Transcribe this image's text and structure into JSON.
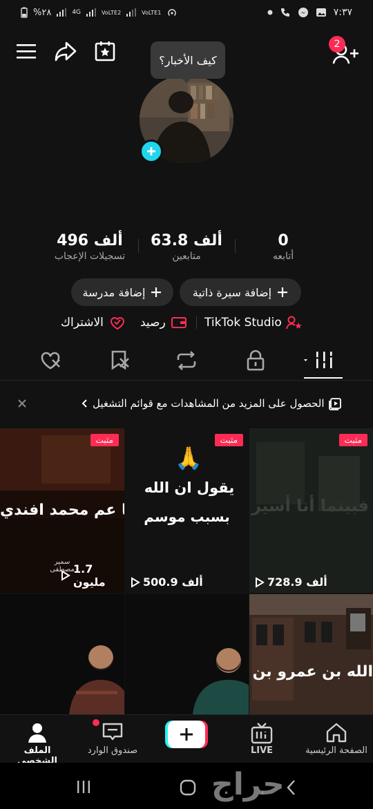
{
  "status_bar": {
    "time": "٧:٣٧",
    "battery": "%٢٨",
    "network_1": "4G",
    "network_2": "VoLTE2",
    "network_3": "VoLTE1"
  },
  "profile": {
    "whats_new_bubble": "كيف الأخبار؟",
    "notification_badge": "2"
  },
  "stats": [
    {
      "value": "0",
      "label": "أتابعه"
    },
    {
      "value": "63.8 ألف",
      "label": "متابعين"
    },
    {
      "value": "496 ألف",
      "label": "تسجيلات الإعجاب"
    }
  ],
  "actions": {
    "add_bio": "إضافة سيرة ذاتية",
    "add_school": "إضافة مدرسة"
  },
  "links": {
    "studio": "TikTok Studio",
    "balance": "رصيد",
    "subscription": "الاشتراك"
  },
  "banner": {
    "text": "الحصول على المزيد من المشاهدات مع قوائم التشغيل"
  },
  "videos": [
    {
      "pinned": "مثبت",
      "views": "728.9 ألف",
      "overlay": "فبينما أنا أسير"
    },
    {
      "pinned": "مثبت",
      "views": "500.9 ألف",
      "overlay_line1": "يقول ان الله",
      "overlay_line2": "بسبب موسم",
      "emoji": "🙏"
    },
    {
      "pinned": "مثبت",
      "views": "1.7 مليون",
      "overlay": "يا عم محمد افندي",
      "caption": "سمير مصطفى"
    },
    {
      "overlay": "الله بن عمرو بن ال"
    },
    {},
    {}
  ],
  "bottom_nav": {
    "home": "الصفحة الرئيسية",
    "live": "LIVE",
    "inbox": "صندوق الوارد",
    "profile": "الملف الشخصي"
  },
  "watermark": "حراج",
  "colors": {
    "accent": "#fe2c55",
    "cyan": "#25f4ee",
    "add_blue": "#20d5ec"
  }
}
